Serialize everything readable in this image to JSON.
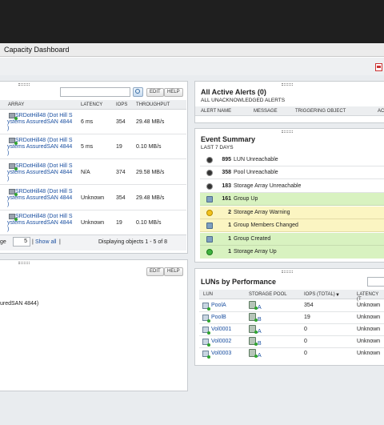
{
  "header": {
    "title": "Capacity Dashboard"
  },
  "toolbar": {
    "export_icon": "pdf-export-icon"
  },
  "array_panel": {
    "buttons": {
      "edit": "EDIT",
      "help": "HELP"
    },
    "columns": [
      "ARRAY",
      "LATENCY",
      "IOPS",
      "THROUGHPUT"
    ],
    "rows": [
      {
        "line1": "SRDotHill48 (Dot Hill S",
        "line2": "ystems AssuredSAN 4844",
        "line3": ")",
        "latency": "6 ms",
        "iops": "354",
        "throughput": "29.48 MB/s"
      },
      {
        "line1": "SRDotHill48 (Dot Hill S",
        "line2": "ystems AssuredSAN 4844",
        "line3": ")",
        "latency": "5 ms",
        "iops": "19",
        "throughput": "0.10 MB/s"
      },
      {
        "line1": "SRDotHill48 (Dot Hill S",
        "line2": "ystems AssuredSAN 4844",
        "line3": ")",
        "latency": "N/A",
        "iops": "374",
        "throughput": "29.58 MB/s"
      },
      {
        "line1": "SRDotHill48 (Dot Hill S",
        "line2": "ystems AssuredSAN 4844",
        "line3": ")",
        "latency": "Unknown",
        "iops": "354",
        "throughput": "29.48 MB/s"
      },
      {
        "line1": "SRDotHill48 (Dot Hill S",
        "line2": "ystems AssuredSAN 4844",
        "line3": ")",
        "latency": "Unknown",
        "iops": "19",
        "throughput": "0.10 MB/s"
      }
    ],
    "footer": {
      "page_prefix": "ge",
      "page_size": "5",
      "show_all": "Show all",
      "sep": "|",
      "status": "Displaying objects 1 - 5 of 8"
    }
  },
  "lower_left_panel": {
    "buttons": {
      "edit": "EDIT",
      "help": "HELP"
    },
    "text": "uredSAN 4844)"
  },
  "alerts": {
    "title": "All Active Alerts (0)",
    "subtitle": "ALL UNACKNOWLEDGED ALERTS",
    "columns": [
      "ALERT NAME",
      "MESSAGE",
      "TRIGGERING OBJECT",
      "AC"
    ]
  },
  "events": {
    "title": "Event Summary",
    "subtitle": "LAST 7 DAYS",
    "rows": [
      {
        "count": "895",
        "text": "LUN Unreachable"
      },
      {
        "count": "358",
        "text": "Pool Unreachable"
      },
      {
        "count": "183",
        "text": "Storage Array Unreachable"
      },
      {
        "count": "161",
        "text": "Group Up"
      },
      {
        "count": "2",
        "text": "Storage Array Warning"
      },
      {
        "count": "1",
        "text": "Group Members Changed"
      },
      {
        "count": "1",
        "text": "Group Created"
      },
      {
        "count": "1",
        "text": "Storage Array Up"
      }
    ]
  },
  "luns": {
    "title": "LUNs by Performance",
    "columns": [
      "LUN",
      "STORAGE POOL",
      "IOPS (TOTAL)",
      "LATENCY (T"
    ],
    "rows": [
      {
        "lun": "PoolA",
        "pool": "A",
        "iops": "354",
        "latency": "Unknown"
      },
      {
        "lun": "PoolB",
        "pool": "B",
        "iops": "19",
        "latency": "Unknown"
      },
      {
        "lun": "Vol0001",
        "pool": "A",
        "iops": "0",
        "latency": "Unknown"
      },
      {
        "lun": "Vol0002",
        "pool": "B",
        "iops": "0",
        "latency": "Unknown"
      },
      {
        "lun": "Vol0003",
        "pool": "A",
        "iops": "0",
        "latency": "Unknown"
      }
    ]
  },
  "colors": {
    "green_row": "#d8f2c0",
    "yellow_row": "#fbf5c2",
    "link": "#1a4fa0"
  }
}
